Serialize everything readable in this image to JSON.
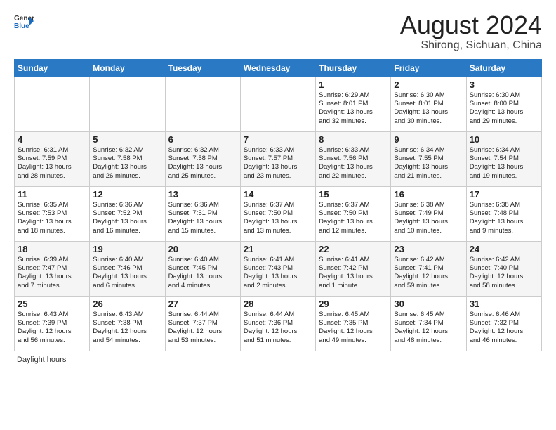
{
  "logo": {
    "general": "General",
    "blue": "Blue"
  },
  "title": {
    "month_year": "August 2024",
    "location": "Shirong, Sichuan, China"
  },
  "weekdays": [
    "Sunday",
    "Monday",
    "Tuesday",
    "Wednesday",
    "Thursday",
    "Friday",
    "Saturday"
  ],
  "weeks": [
    [
      {
        "day": "",
        "lines": []
      },
      {
        "day": "",
        "lines": []
      },
      {
        "day": "",
        "lines": []
      },
      {
        "day": "",
        "lines": []
      },
      {
        "day": "1",
        "lines": [
          "Sunrise: 6:29 AM",
          "Sunset: 8:01 PM",
          "Daylight: 13 hours",
          "and 32 minutes."
        ]
      },
      {
        "day": "2",
        "lines": [
          "Sunrise: 6:30 AM",
          "Sunset: 8:01 PM",
          "Daylight: 13 hours",
          "and 30 minutes."
        ]
      },
      {
        "day": "3",
        "lines": [
          "Sunrise: 6:30 AM",
          "Sunset: 8:00 PM",
          "Daylight: 13 hours",
          "and 29 minutes."
        ]
      }
    ],
    [
      {
        "day": "4",
        "lines": [
          "Sunrise: 6:31 AM",
          "Sunset: 7:59 PM",
          "Daylight: 13 hours",
          "and 28 minutes."
        ]
      },
      {
        "day": "5",
        "lines": [
          "Sunrise: 6:32 AM",
          "Sunset: 7:58 PM",
          "Daylight: 13 hours",
          "and 26 minutes."
        ]
      },
      {
        "day": "6",
        "lines": [
          "Sunrise: 6:32 AM",
          "Sunset: 7:58 PM",
          "Daylight: 13 hours",
          "and 25 minutes."
        ]
      },
      {
        "day": "7",
        "lines": [
          "Sunrise: 6:33 AM",
          "Sunset: 7:57 PM",
          "Daylight: 13 hours",
          "and 23 minutes."
        ]
      },
      {
        "day": "8",
        "lines": [
          "Sunrise: 6:33 AM",
          "Sunset: 7:56 PM",
          "Daylight: 13 hours",
          "and 22 minutes."
        ]
      },
      {
        "day": "9",
        "lines": [
          "Sunrise: 6:34 AM",
          "Sunset: 7:55 PM",
          "Daylight: 13 hours",
          "and 21 minutes."
        ]
      },
      {
        "day": "10",
        "lines": [
          "Sunrise: 6:34 AM",
          "Sunset: 7:54 PM",
          "Daylight: 13 hours",
          "and 19 minutes."
        ]
      }
    ],
    [
      {
        "day": "11",
        "lines": [
          "Sunrise: 6:35 AM",
          "Sunset: 7:53 PM",
          "Daylight: 13 hours",
          "and 18 minutes."
        ]
      },
      {
        "day": "12",
        "lines": [
          "Sunrise: 6:36 AM",
          "Sunset: 7:52 PM",
          "Daylight: 13 hours",
          "and 16 minutes."
        ]
      },
      {
        "day": "13",
        "lines": [
          "Sunrise: 6:36 AM",
          "Sunset: 7:51 PM",
          "Daylight: 13 hours",
          "and 15 minutes."
        ]
      },
      {
        "day": "14",
        "lines": [
          "Sunrise: 6:37 AM",
          "Sunset: 7:50 PM",
          "Daylight: 13 hours",
          "and 13 minutes."
        ]
      },
      {
        "day": "15",
        "lines": [
          "Sunrise: 6:37 AM",
          "Sunset: 7:50 PM",
          "Daylight: 13 hours",
          "and 12 minutes."
        ]
      },
      {
        "day": "16",
        "lines": [
          "Sunrise: 6:38 AM",
          "Sunset: 7:49 PM",
          "Daylight: 13 hours",
          "and 10 minutes."
        ]
      },
      {
        "day": "17",
        "lines": [
          "Sunrise: 6:38 AM",
          "Sunset: 7:48 PM",
          "Daylight: 13 hours",
          "and 9 minutes."
        ]
      }
    ],
    [
      {
        "day": "18",
        "lines": [
          "Sunrise: 6:39 AM",
          "Sunset: 7:47 PM",
          "Daylight: 13 hours",
          "and 7 minutes."
        ]
      },
      {
        "day": "19",
        "lines": [
          "Sunrise: 6:40 AM",
          "Sunset: 7:46 PM",
          "Daylight: 13 hours",
          "and 6 minutes."
        ]
      },
      {
        "day": "20",
        "lines": [
          "Sunrise: 6:40 AM",
          "Sunset: 7:45 PM",
          "Daylight: 13 hours",
          "and 4 minutes."
        ]
      },
      {
        "day": "21",
        "lines": [
          "Sunrise: 6:41 AM",
          "Sunset: 7:43 PM",
          "Daylight: 13 hours",
          "and 2 minutes."
        ]
      },
      {
        "day": "22",
        "lines": [
          "Sunrise: 6:41 AM",
          "Sunset: 7:42 PM",
          "Daylight: 13 hours",
          "and 1 minute."
        ]
      },
      {
        "day": "23",
        "lines": [
          "Sunrise: 6:42 AM",
          "Sunset: 7:41 PM",
          "Daylight: 12 hours",
          "and 59 minutes."
        ]
      },
      {
        "day": "24",
        "lines": [
          "Sunrise: 6:42 AM",
          "Sunset: 7:40 PM",
          "Daylight: 12 hours",
          "and 58 minutes."
        ]
      }
    ],
    [
      {
        "day": "25",
        "lines": [
          "Sunrise: 6:43 AM",
          "Sunset: 7:39 PM",
          "Daylight: 12 hours",
          "and 56 minutes."
        ]
      },
      {
        "day": "26",
        "lines": [
          "Sunrise: 6:43 AM",
          "Sunset: 7:38 PM",
          "Daylight: 12 hours",
          "and 54 minutes."
        ]
      },
      {
        "day": "27",
        "lines": [
          "Sunrise: 6:44 AM",
          "Sunset: 7:37 PM",
          "Daylight: 12 hours",
          "and 53 minutes."
        ]
      },
      {
        "day": "28",
        "lines": [
          "Sunrise: 6:44 AM",
          "Sunset: 7:36 PM",
          "Daylight: 12 hours",
          "and 51 minutes."
        ]
      },
      {
        "day": "29",
        "lines": [
          "Sunrise: 6:45 AM",
          "Sunset: 7:35 PM",
          "Daylight: 12 hours",
          "and 49 minutes."
        ]
      },
      {
        "day": "30",
        "lines": [
          "Sunrise: 6:45 AM",
          "Sunset: 7:34 PM",
          "Daylight: 12 hours",
          "and 48 minutes."
        ]
      },
      {
        "day": "31",
        "lines": [
          "Sunrise: 6:46 AM",
          "Sunset: 7:32 PM",
          "Daylight: 12 hours",
          "and 46 minutes."
        ]
      }
    ]
  ],
  "footer": "Daylight hours"
}
